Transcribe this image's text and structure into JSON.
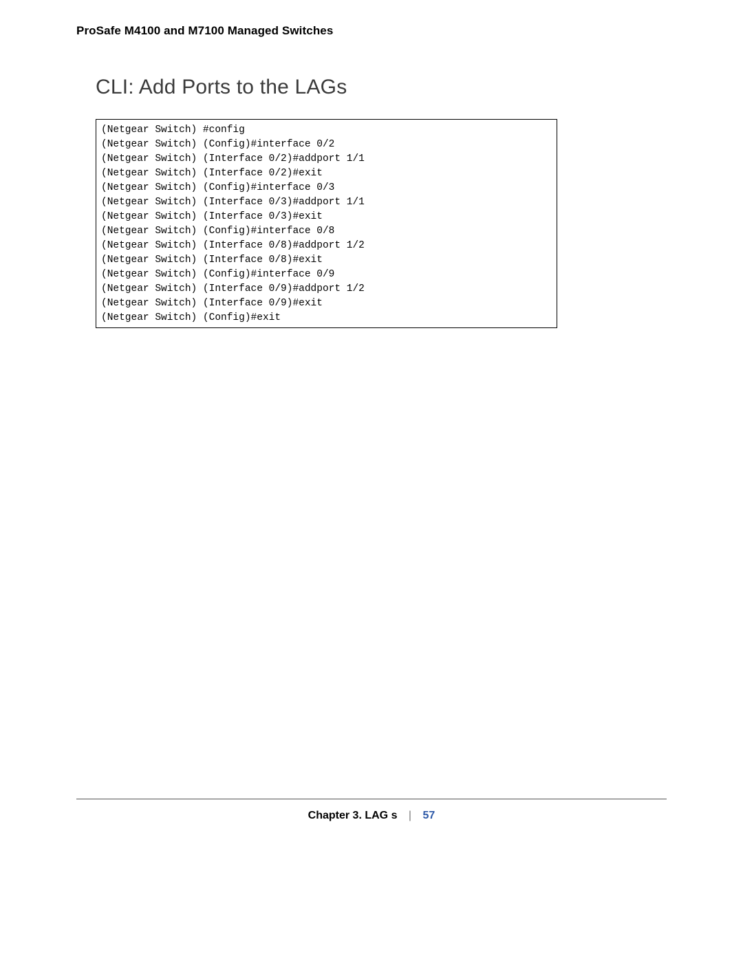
{
  "header": {
    "title": "ProSafe M4100 and M7100 Managed Switches"
  },
  "section": {
    "heading": "CLI: Add Ports to the LAGs"
  },
  "code": {
    "lines": [
      "(Netgear Switch) #config",
      "(Netgear Switch) (Config)#interface 0/2",
      "(Netgear Switch) (Interface 0/2)#addport 1/1",
      "(Netgear Switch) (Interface 0/2)#exit",
      "(Netgear Switch) (Config)#interface 0/3",
      "(Netgear Switch) (Interface 0/3)#addport 1/1",
      "(Netgear Switch) (Interface 0/3)#exit",
      "(Netgear Switch) (Config)#interface 0/8",
      "(Netgear Switch) (Interface 0/8)#addport 1/2",
      "(Netgear Switch) (Interface 0/8)#exit",
      "(Netgear Switch) (Config)#interface 0/9",
      "(Netgear Switch) (Interface 0/9)#addport 1/2",
      "(Netgear Switch) (Interface 0/9)#exit",
      "(Netgear Switch) (Config)#exit"
    ]
  },
  "footer": {
    "chapter_text": "Chapter 3.  LAG s",
    "separator": "|",
    "page_number": "57"
  }
}
